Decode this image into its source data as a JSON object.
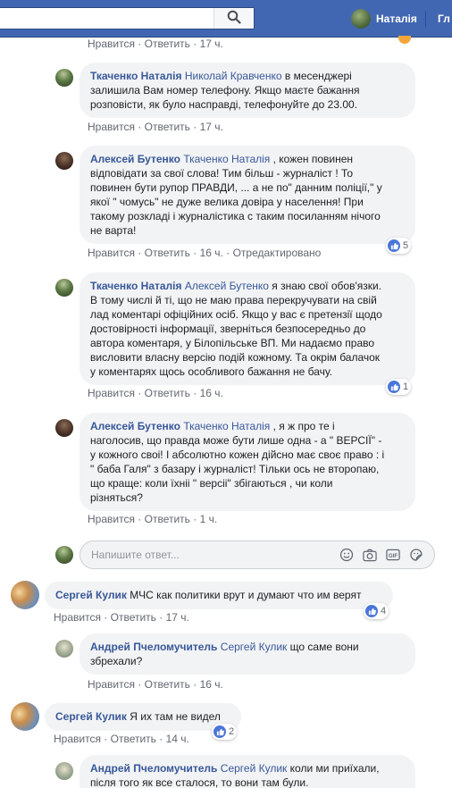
{
  "topbar": {
    "user_name": "Наталія",
    "home_label": "Гл"
  },
  "actions": {
    "like": "Нравится",
    "reply": "Ответить",
    "sep": "·"
  },
  "comments": [
    {
      "time": "17 ч."
    },
    {
      "author": "Ткаченко Наталія",
      "mention": "Николай Кравченко",
      "lines": [
        " в месенджері",
        "залишила Вам номер телефону. Якщо маєте бажання",
        "розповісти, як було насправді, телефонуйте до 23.00."
      ],
      "time": "17 ч."
    },
    {
      "author": "Алексей Бутенко",
      "mention": "Ткаченко Наталія",
      "lines": [
        " , кожен повинен",
        "відповідати за свої слова! Тим більш - журналіст ! То",
        "повинен бути рупор ПРАВДИ, ... а не по\" данним поліції,\" у",
        "якої \" чомусь\" не дуже велика довіра у населення! При",
        "такому розкладі і журналістика с таким посиланням нічого",
        "не варта!"
      ],
      "time": "16 ч.",
      "edited": "Отредактировано",
      "likes": "5"
    },
    {
      "author": "Ткаченко Наталія",
      "mention": "Алексей Бутенко",
      "lines": [
        " я знаю свої обов'язки.",
        "В тому числі й ті, що не маю права перекручувати на свій",
        "лад коментарі офіційних осіб. Якщо у вас є претензії щодо",
        "достовірності інформації, зверніться безпосередньо до",
        "автора коментаря, у Білопільське ВП. Ми надаємо право",
        "висловити власну версію подій кожному. Та окрім балачок",
        "у коментарях щось особливого бажання не бачу."
      ],
      "time": "16 ч.",
      "likes": "1"
    },
    {
      "author": "Алексей Бутенко",
      "mention": "Ткаченко Наталія",
      "lines": [
        " , я ж про те і",
        "наголосив, що правда може бути лише одна - а \" ВЕРСІЇ\" -",
        "у кожного своі! І абсолютно кожен дійсно має своє право : і",
        "\" баба Галя\" з базару і журналіст! Тільки ось не второпаю,",
        "що краще: коли їхніі \" версіі\" збігаються , чи коли",
        "різняться?"
      ],
      "time": "1 ч."
    },
    {
      "author": "Сергей Кулик",
      "lines": [
        " МЧС как политики врут и думают что им верят"
      ],
      "time": "17 ч.",
      "likes": "4"
    },
    {
      "author": "Андрей Пчеломучитель",
      "mention": "Сергей Кулик",
      "lines": [
        " що саме вони",
        "збрехали?"
      ],
      "time": "16 ч."
    },
    {
      "author": "Сергей Кулик",
      "lines": [
        " Я их там не видел"
      ],
      "time": "14 ч.",
      "likes": "2"
    },
    {
      "author": "Андрей Пчеломучитель",
      "mention": "Сергей Кулик",
      "lines": [
        " коли ми приїхали,",
        "після того як все сталося, то вони там були."
      ]
    }
  ],
  "reply_box": {
    "placeholder": "Напишите ответ..."
  },
  "colors": {
    "topbar": "#4267b2",
    "link": "#385898",
    "bubble": "#f2f3f5",
    "like": "#4a76d9"
  }
}
